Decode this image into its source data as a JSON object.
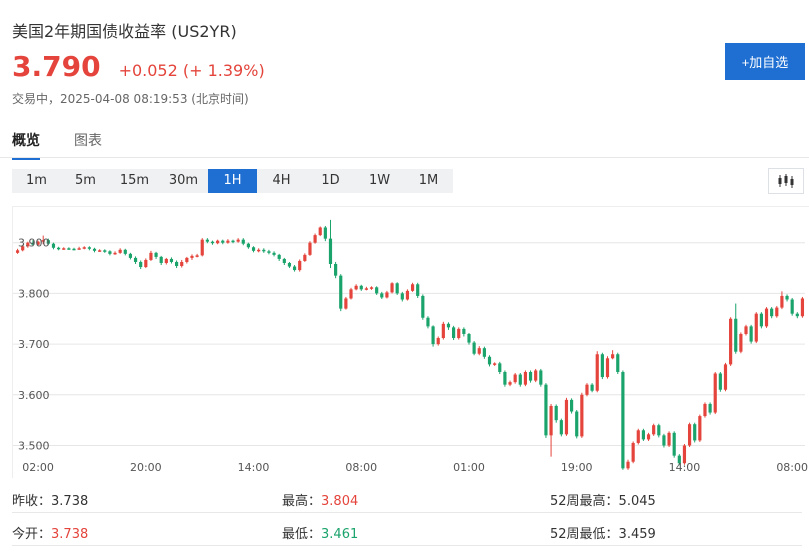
{
  "header": {
    "title": "美国2年期国债收益率 (US2YR)",
    "price": "3.790",
    "change": "+0.052 (+ 1.39%)",
    "status": "交易中，2025-04-08 08:19:53 (北京时间)",
    "add_button": "+加自选"
  },
  "tabs": [
    {
      "label": "概览",
      "active": true
    },
    {
      "label": "图表",
      "active": false
    }
  ],
  "intervals": [
    {
      "label": "1m"
    },
    {
      "label": "5m"
    },
    {
      "label": "15m"
    },
    {
      "label": "30m"
    },
    {
      "label": "1H",
      "active": true
    },
    {
      "label": "4H"
    },
    {
      "label": "1D"
    },
    {
      "label": "1W"
    },
    {
      "label": "1M"
    }
  ],
  "chart_type_icon": "candlestick-icon",
  "colors": {
    "up": "#e4443b",
    "down": "#1aa36b",
    "accent": "#1f6fd3",
    "grid": "#e6e6e6"
  },
  "chart_data": {
    "type": "candlestick",
    "yticks": [
      "3.900",
      "3.800",
      "3.700",
      "3.600",
      "3.500"
    ],
    "ytick_values": [
      3.9,
      3.8,
      3.7,
      3.6,
      3.5
    ],
    "ylim": [
      3.45,
      3.96
    ],
    "xticks": [
      "02:00",
      "20:00",
      "14:00",
      "08:00",
      "01:00",
      "19:00",
      "14:00",
      "08:00"
    ],
    "xtick_index": [
      4,
      25,
      46,
      67,
      88,
      109,
      130,
      151
    ],
    "grid": "horizontal",
    "candles": [
      [
        3.88,
        3.885,
        3.878,
        3.888
      ],
      [
        3.885,
        3.893,
        3.883,
        3.896
      ],
      [
        3.893,
        3.9,
        3.89,
        3.902
      ],
      [
        3.9,
        3.896,
        3.893,
        3.905
      ],
      [
        3.896,
        3.902,
        3.894,
        3.904
      ],
      [
        3.902,
        3.905,
        3.897,
        3.914
      ],
      [
        3.905,
        3.898,
        3.895,
        3.908
      ],
      [
        3.898,
        3.89,
        3.887,
        3.9
      ],
      [
        3.89,
        3.888,
        3.885,
        3.892
      ],
      [
        3.888,
        3.889,
        3.886,
        3.891
      ],
      [
        3.889,
        3.888,
        3.886,
        3.891
      ],
      [
        3.888,
        3.887,
        3.885,
        3.89
      ],
      [
        3.887,
        3.889,
        3.886,
        3.892
      ],
      [
        3.889,
        3.891,
        3.887,
        3.893
      ],
      [
        3.891,
        3.888,
        3.885,
        3.893
      ],
      [
        3.888,
        3.884,
        3.881,
        3.89
      ],
      [
        3.884,
        3.885,
        3.882,
        3.887
      ],
      [
        3.885,
        3.883,
        3.88,
        3.887
      ],
      [
        3.883,
        3.878,
        3.875,
        3.885
      ],
      [
        3.878,
        3.88,
        3.876,
        3.883
      ],
      [
        3.88,
        3.886,
        3.878,
        3.889
      ],
      [
        3.886,
        3.878,
        3.875,
        3.888
      ],
      [
        3.878,
        3.87,
        3.867,
        3.88
      ],
      [
        3.87,
        3.862,
        3.858,
        3.873
      ],
      [
        3.862,
        3.852,
        3.848,
        3.865
      ],
      [
        3.852,
        3.866,
        3.85,
        3.869
      ],
      [
        3.866,
        3.88,
        3.864,
        3.884
      ],
      [
        3.88,
        3.872,
        3.868,
        3.882
      ],
      [
        3.872,
        3.86,
        3.856,
        3.874
      ],
      [
        3.86,
        3.868,
        3.857,
        3.87
      ],
      [
        3.868,
        3.862,
        3.859,
        3.871
      ],
      [
        3.862,
        3.854,
        3.85,
        3.865
      ],
      [
        3.854,
        3.862,
        3.851,
        3.866
      ],
      [
        3.862,
        3.87,
        3.859,
        3.872
      ],
      [
        3.87,
        3.874,
        3.866,
        3.877
      ],
      [
        3.874,
        3.875,
        3.871,
        3.878
      ],
      [
        3.875,
        3.906,
        3.873,
        3.909
      ],
      [
        3.906,
        3.902,
        3.899,
        3.909
      ],
      [
        3.902,
        3.899,
        3.896,
        3.904
      ],
      [
        3.899,
        3.904,
        3.897,
        3.906
      ],
      [
        3.904,
        3.9,
        3.897,
        3.906
      ],
      [
        3.9,
        3.904,
        3.898,
        3.907
      ],
      [
        3.904,
        3.902,
        3.899,
        3.906
      ],
      [
        3.902,
        3.906,
        3.9,
        3.909
      ],
      [
        3.906,
        3.898,
        3.895,
        3.909
      ],
      [
        3.898,
        3.891,
        3.888,
        3.9
      ],
      [
        3.891,
        3.884,
        3.881,
        3.893
      ],
      [
        3.884,
        3.886,
        3.881,
        3.889
      ],
      [
        3.886,
        3.883,
        3.88,
        3.889
      ],
      [
        3.883,
        3.88,
        3.877,
        3.886
      ],
      [
        3.88,
        3.876,
        3.873,
        3.883
      ],
      [
        3.876,
        3.868,
        3.864,
        3.878
      ],
      [
        3.868,
        3.86,
        3.856,
        3.87
      ],
      [
        3.86,
        3.853,
        3.85,
        3.862
      ],
      [
        3.853,
        3.846,
        3.843,
        3.856
      ],
      [
        3.846,
        3.864,
        3.843,
        3.867
      ],
      [
        3.864,
        3.876,
        3.862,
        3.879
      ],
      [
        3.876,
        3.9,
        3.874,
        3.903
      ],
      [
        3.9,
        3.915,
        3.898,
        3.918
      ],
      [
        3.915,
        3.93,
        3.913,
        3.932
      ],
      [
        3.93,
        3.908,
        3.903,
        3.933
      ],
      [
        3.908,
        3.858,
        3.85,
        3.945
      ],
      [
        3.858,
        3.835,
        3.83,
        3.862
      ],
      [
        3.835,
        3.77,
        3.765,
        3.838
      ],
      [
        3.77,
        3.79,
        3.768,
        3.793
      ],
      [
        3.79,
        3.808,
        3.788,
        3.811
      ],
      [
        3.808,
        3.815,
        3.806,
        3.818
      ],
      [
        3.815,
        3.808,
        3.805,
        3.817
      ],
      [
        3.808,
        3.81,
        3.806,
        3.813
      ],
      [
        3.81,
        3.812,
        3.807,
        3.814
      ],
      [
        3.812,
        3.8,
        3.797,
        3.814
      ],
      [
        3.8,
        3.792,
        3.789,
        3.803
      ],
      [
        3.792,
        3.802,
        3.79,
        3.805
      ],
      [
        3.802,
        3.82,
        3.8,
        3.822
      ],
      [
        3.82,
        3.8,
        3.797,
        3.822
      ],
      [
        3.8,
        3.788,
        3.784,
        3.803
      ],
      [
        3.788,
        3.805,
        3.786,
        3.808
      ],
      [
        3.805,
        3.818,
        3.803,
        3.821
      ],
      [
        3.818,
        3.795,
        3.791,
        3.821
      ],
      [
        3.795,
        3.752,
        3.748,
        3.798
      ],
      [
        3.752,
        3.735,
        3.731,
        3.755
      ],
      [
        3.735,
        3.7,
        3.695,
        3.737
      ],
      [
        3.7,
        3.712,
        3.697,
        3.715
      ],
      [
        3.712,
        3.74,
        3.709,
        3.744
      ],
      [
        3.74,
        3.733,
        3.728,
        3.743
      ],
      [
        3.733,
        3.712,
        3.708,
        3.736
      ],
      [
        3.712,
        3.73,
        3.709,
        3.733
      ],
      [
        3.73,
        3.72,
        3.715,
        3.733
      ],
      [
        3.72,
        3.703,
        3.699,
        3.722
      ],
      [
        3.703,
        3.681,
        3.678,
        3.706
      ],
      [
        3.681,
        3.692,
        3.678,
        3.696
      ],
      [
        3.692,
        3.675,
        3.671,
        3.695
      ],
      [
        3.675,
        3.66,
        3.656,
        3.678
      ],
      [
        3.66,
        3.662,
        3.657,
        3.664
      ],
      [
        3.662,
        3.645,
        3.641,
        3.665
      ],
      [
        3.645,
        3.62,
        3.616,
        3.648
      ],
      [
        3.62,
        3.625,
        3.617,
        3.628
      ],
      [
        3.625,
        3.64,
        3.622,
        3.643
      ],
      [
        3.64,
        3.62,
        3.616,
        3.643
      ],
      [
        3.62,
        3.645,
        3.617,
        3.648
      ],
      [
        3.645,
        3.628,
        3.624,
        3.648
      ],
      [
        3.628,
        3.648,
        3.625,
        3.651
      ],
      [
        3.648,
        3.62,
        3.616,
        3.651
      ],
      [
        3.62,
        3.52,
        3.515,
        3.623
      ],
      [
        3.52,
        3.578,
        3.478,
        3.582
      ],
      [
        3.578,
        3.55,
        3.545,
        3.581
      ],
      [
        3.55,
        3.522,
        3.518,
        3.553
      ],
      [
        3.522,
        3.59,
        3.519,
        3.594
      ],
      [
        3.59,
        3.567,
        3.563,
        3.593
      ],
      [
        3.567,
        3.518,
        3.514,
        3.57
      ],
      [
        3.518,
        3.6,
        3.515,
        3.604
      ],
      [
        3.6,
        3.62,
        3.597,
        3.623
      ],
      [
        3.62,
        3.608,
        3.605,
        3.623
      ],
      [
        3.608,
        3.68,
        3.605,
        3.686
      ],
      [
        3.68,
        3.635,
        3.631,
        3.683
      ],
      [
        3.635,
        3.672,
        3.632,
        3.676
      ],
      [
        3.672,
        3.68,
        3.67,
        3.688
      ],
      [
        3.68,
        3.645,
        3.641,
        3.683
      ],
      [
        3.645,
        3.455,
        3.452,
        3.648
      ],
      [
        3.455,
        3.468,
        3.452,
        3.472
      ],
      [
        3.468,
        3.505,
        3.465,
        3.508
      ],
      [
        3.505,
        3.53,
        3.502,
        3.533
      ],
      [
        3.53,
        3.512,
        3.509,
        3.533
      ],
      [
        3.512,
        3.522,
        3.509,
        3.525
      ],
      [
        3.522,
        3.54,
        3.519,
        3.543
      ],
      [
        3.54,
        3.52,
        3.516,
        3.543
      ],
      [
        3.52,
        3.5,
        3.496,
        3.523
      ],
      [
        3.5,
        3.525,
        3.497,
        3.528
      ],
      [
        3.525,
        3.48,
        3.476,
        3.528
      ],
      [
        3.48,
        3.465,
        3.461,
        3.483
      ],
      [
        3.465,
        3.5,
        3.462,
        3.503
      ],
      [
        3.5,
        3.542,
        3.497,
        3.545
      ],
      [
        3.542,
        3.51,
        3.506,
        3.545
      ],
      [
        3.51,
        3.558,
        3.507,
        3.561
      ],
      [
        3.558,
        3.582,
        3.555,
        3.585
      ],
      [
        3.582,
        3.565,
        3.561,
        3.585
      ],
      [
        3.565,
        3.642,
        3.562,
        3.645
      ],
      [
        3.642,
        3.61,
        3.606,
        3.645
      ],
      [
        3.61,
        3.66,
        3.607,
        3.663
      ],
      [
        3.66,
        3.75,
        3.657,
        3.753
      ],
      [
        3.75,
        3.685,
        3.681,
        3.78
      ],
      [
        3.685,
        3.72,
        3.682,
        3.723
      ],
      [
        3.72,
        3.735,
        3.717,
        3.738
      ],
      [
        3.735,
        3.705,
        3.701,
        3.738
      ],
      [
        3.705,
        3.76,
        3.702,
        3.763
      ],
      [
        3.76,
        3.735,
        3.731,
        3.763
      ],
      [
        3.735,
        3.77,
        3.732,
        3.773
      ],
      [
        3.77,
        3.755,
        3.751,
        3.773
      ],
      [
        3.755,
        3.772,
        3.752,
        3.775
      ],
      [
        3.772,
        3.795,
        3.769,
        3.804
      ],
      [
        3.795,
        3.788,
        3.784,
        3.798
      ],
      [
        3.788,
        3.76,
        3.756,
        3.791
      ],
      [
        3.76,
        3.755,
        3.751,
        3.763
      ],
      [
        3.755,
        3.79,
        3.752,
        3.793
      ]
    ]
  },
  "stats": [
    [
      {
        "label": "昨收：",
        "value": "3.738",
        "tone": "none"
      },
      {
        "label": "最高：",
        "value": "3.804",
        "tone": "up"
      },
      {
        "label": "52周最高：",
        "value": "5.045",
        "tone": "none"
      }
    ],
    [
      {
        "label": "今开：",
        "value": "3.738",
        "tone": "up"
      },
      {
        "label": "最低：",
        "value": "3.461",
        "tone": "down"
      },
      {
        "label": "52周最低：",
        "value": "3.459",
        "tone": "none"
      }
    ]
  ]
}
